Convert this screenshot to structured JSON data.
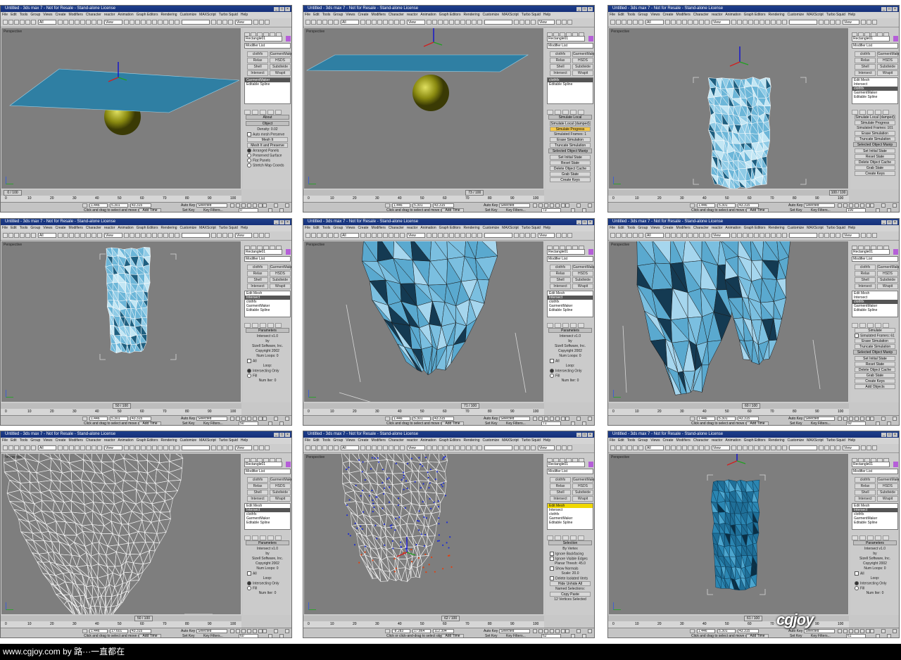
{
  "window_title": "Untitled - 3ds max 7 - Not for Resale - Stand-alone License",
  "menu": [
    "File",
    "Edit",
    "Tools",
    "Group",
    "Views",
    "Create",
    "Modifiers",
    "Character",
    "reactor",
    "Animation",
    "Graph Editors",
    "Rendering",
    "Customize",
    "MAXScript",
    "Turbo Squid",
    "Help"
  ],
  "toolbar": {
    "filter": "All",
    "view": "View",
    "ref": "View"
  },
  "viewport_label": "Perspective",
  "object_name": "Rectangle01",
  "modifier_list": "Modifier List",
  "modifier_buttons": [
    "clothfx",
    "GarmentMaker",
    "Relax",
    "HSDS",
    "Shell",
    "Subdivide",
    "Intersect",
    "Wrapit"
  ],
  "status": {
    "hint": "Click and drag to select and move objects",
    "hint2": "Click or click-and-drag to select objects",
    "add_time_tag": "Add Time Tag",
    "auto_key": "Auto Key",
    "set_key": "Set Key",
    "key_filters": "Key Filters...",
    "selected": "Selected"
  },
  "ruler": [
    "0",
    "10",
    "20",
    "30",
    "40",
    "50",
    "60",
    "70",
    "80",
    "90",
    "100"
  ],
  "panels": [
    {
      "frame": "0 / 100",
      "fv": "0",
      "x": "1.446",
      "y": "5.301",
      "z": "43.315",
      "mode": "plane",
      "stack": [
        "GarmentMaker",
        "Editable Spline"
      ],
      "sel": 0,
      "rollouts": [
        {
          "type": "hdr",
          "t": "About"
        },
        {
          "type": "hdr",
          "t": "Object"
        },
        {
          "type": "label",
          "t": "Density: 0.02"
        },
        {
          "type": "check",
          "t": "Auto mesh   Preserve"
        },
        {
          "type": "btn",
          "t": "Mesh It"
        },
        {
          "type": "btn",
          "t": "Mesh It and Preserve"
        },
        {
          "type": "radio",
          "t": "Arranged Panels",
          "on": true
        },
        {
          "type": "radio",
          "t": "Preserved Surface"
        },
        {
          "type": "radio",
          "t": "Flat Panels"
        },
        {
          "type": "radio",
          "t": "Stretch Map Coords"
        }
      ]
    },
    {
      "frame": "73 / 100",
      "fv": "73",
      "x": "1.446",
      "y": "5.301",
      "z": "43.315",
      "mode": "plane2",
      "stack": [
        "clothfx",
        "Editable Spline"
      ],
      "sel": 0,
      "rollouts": [
        {
          "type": "hdr",
          "t": "Simulate Local"
        },
        {
          "type": "btn",
          "t": "Simulate Local (damped)"
        },
        {
          "type": "btn",
          "t": "Simulate   Progress",
          "hl": true
        },
        {
          "type": "label",
          "t": "Simulated Frames:  1"
        },
        {
          "type": "btn",
          "t": "Erase Simulation"
        },
        {
          "type": "btn",
          "t": "Truncate Simulation"
        },
        {
          "type": "hdr",
          "t": "Selected Object Manip"
        },
        {
          "type": "btn",
          "t": "Set Initial State"
        },
        {
          "type": "btn",
          "t": "Reset State"
        },
        {
          "type": "btn",
          "t": "Delete Object Cache"
        },
        {
          "type": "btn",
          "t": "Grab State"
        },
        {
          "type": "btn",
          "t": "Create Keys"
        }
      ]
    },
    {
      "frame": "100 / 100",
      "fv": "100",
      "x": "1.446",
      "y": "5.301",
      "z": "43.315",
      "mode": "cloth_small",
      "stack": [
        "Edit Mesh",
        "Intersect",
        "clothfx",
        "GarmentMaker",
        "Editable Spline"
      ],
      "sel": 2,
      "rollouts": [
        {
          "type": "btn",
          "t": "Simulate Local (damped)"
        },
        {
          "type": "btn",
          "t": "Simulate   Progress"
        },
        {
          "type": "label",
          "t": "Simulated Frames:  101"
        },
        {
          "type": "btn",
          "t": "Erase Simulation"
        },
        {
          "type": "btn",
          "t": "Truncate Simulation"
        },
        {
          "type": "hdr",
          "t": "Selected Object Manip"
        },
        {
          "type": "btn",
          "t": "Set Initial State"
        },
        {
          "type": "btn",
          "t": "Reset State"
        },
        {
          "type": "btn",
          "t": "Delete Object Cache"
        },
        {
          "type": "btn",
          "t": "Grab State"
        },
        {
          "type": "btn",
          "t": "Create Keys"
        }
      ]
    },
    {
      "frame": "50 / 100",
      "fv": "50",
      "x": "1.446",
      "y": "5.301",
      "z": "43.315",
      "mode": "cloth_narrow",
      "stack": [
        "Edit Mesh",
        "Intersect",
        "clothfx",
        "GarmentMaker",
        "Editable Spline"
      ],
      "sel": 1,
      "rollouts": [
        {
          "type": "hdr",
          "t": "Parameters"
        },
        {
          "type": "label",
          "t": "Intersect v1.0"
        },
        {
          "type": "label",
          "t": "by"
        },
        {
          "type": "label",
          "t": "Sizell Software, Inc."
        },
        {
          "type": "label",
          "t": "Copyright 2002"
        },
        {
          "type": "label",
          "t": "Num Loops:   0"
        },
        {
          "type": "check",
          "t": "All"
        },
        {
          "type": "label",
          "t": "Loop:"
        },
        {
          "type": "radio",
          "t": "Intersecting Only",
          "on": true
        },
        {
          "type": "radio",
          "t": "Fill"
        },
        {
          "type": "label",
          "t": "Num Iter:   0"
        }
      ]
    },
    {
      "frame": "71 / 100",
      "fv": "71",
      "x": "1.446",
      "y": "5.301",
      "z": "43.315",
      "mode": "cloth_zoom",
      "stack": [
        "Edit Mesh",
        "Intersect",
        "clothfx",
        "GarmentMaker",
        "Editable Spline"
      ],
      "sel": 1,
      "rollouts": [
        {
          "type": "hdr",
          "t": "Parameters"
        },
        {
          "type": "label",
          "t": "Intersect v1.0"
        },
        {
          "type": "label",
          "t": "by"
        },
        {
          "type": "label",
          "t": "Sizell Software, Inc."
        },
        {
          "type": "label",
          "t": "Copyright 2002"
        },
        {
          "type": "label",
          "t": "Num Loops:   0"
        },
        {
          "type": "check",
          "t": "All"
        },
        {
          "type": "label",
          "t": "Loop:"
        },
        {
          "type": "radio",
          "t": "Intersecting Only",
          "on": true
        },
        {
          "type": "radio",
          "t": "Fill"
        },
        {
          "type": "label",
          "t": "Num Iter:   0"
        }
      ]
    },
    {
      "frame": "60 / 100",
      "fv": "60",
      "x": "1.446",
      "y": "5.301",
      "z": "43.315",
      "mode": "cloth_zoom2",
      "stack": [
        "Edit Mesh",
        "Intersect",
        "clothfx",
        "GarmentMaker",
        "Editable Spline"
      ],
      "sel": 2,
      "rollouts": [
        {
          "type": "btn",
          "t": "Simulate"
        },
        {
          "type": "check",
          "t": "Simulated Frames:  61"
        },
        {
          "type": "btn",
          "t": "Erase Simulation"
        },
        {
          "type": "btn",
          "t": "Truncate Simulation"
        },
        {
          "type": "hdr",
          "t": "Selected Object Manip"
        },
        {
          "type": "btn",
          "t": "Set Initial State"
        },
        {
          "type": "btn",
          "t": "Reset State"
        },
        {
          "type": "btn",
          "t": "Delete Object Cache"
        },
        {
          "type": "btn",
          "t": "Grab State"
        },
        {
          "type": "btn",
          "t": "Create Keys"
        },
        {
          "type": "btn",
          "t": "Add Objects"
        }
      ]
    },
    {
      "frame": "50 / 100",
      "fv": "60",
      "x": "1.446",
      "y": "17.601",
      "z": "43.315",
      "mode": "wire_white",
      "stack": [
        "Edit Mesh",
        "Intersect",
        "clothfx",
        "GarmentMaker",
        "Editable Spline"
      ],
      "sel": 1,
      "rollouts": [
        {
          "type": "hdr",
          "t": "Parameters"
        },
        {
          "type": "label",
          "t": "Intersect v1.0"
        },
        {
          "type": "label",
          "t": "by"
        },
        {
          "type": "label",
          "t": "Sizell Software, Inc."
        },
        {
          "type": "label",
          "t": "Copyright 2002"
        },
        {
          "type": "label",
          "t": "Num Loops:   0"
        },
        {
          "type": "check",
          "t": "All"
        },
        {
          "type": "label",
          "t": "Loop:"
        },
        {
          "type": "radio",
          "t": "Intersecting Only",
          "on": true
        },
        {
          "type": "radio",
          "t": "Fill"
        },
        {
          "type": "label",
          "t": "Num Iter:   0"
        }
      ]
    },
    {
      "frame": "62 / 100",
      "fv": "62",
      "x": "-8.283",
      "y": "17.864",
      "z": "112.394",
      "mode": "wire_blue",
      "stack": [
        "Edit Mesh",
        "Intersect",
        "clothfx",
        "GarmentMaker",
        "Editable Spline"
      ],
      "sel": 0,
      "yel": true,
      "rollouts": [
        {
          "type": "hdr",
          "t": "Selection"
        },
        {
          "type": "label",
          "t": "By Vertex"
        },
        {
          "type": "check",
          "t": "Ignore Backfacing"
        },
        {
          "type": "check",
          "t": "Ignore Visible Edges"
        },
        {
          "type": "label",
          "t": "Planar Thresh: 45.0"
        },
        {
          "type": "check",
          "t": "Show Normals"
        },
        {
          "type": "label",
          "t": "Scale: 20.0"
        },
        {
          "type": "check",
          "t": "Delete Isolated Verts"
        },
        {
          "type": "btn",
          "t": "Hide   Unhide All"
        },
        {
          "type": "label",
          "t": "Named Selections:"
        },
        {
          "type": "btn",
          "t": "Copy   Paste"
        },
        {
          "type": "label",
          "t": "12 Vertices Selected"
        }
      ]
    },
    {
      "frame": "61 / 100",
      "fv": "61",
      "x": "1.446",
      "y": "5.301",
      "z": "43.315",
      "mode": "cloth_dark",
      "stack": [
        "Edit Mesh",
        "Intersect",
        "clothfx",
        "GarmentMaker",
        "Editable Spline"
      ],
      "sel": 1,
      "rollouts": [
        {
          "type": "hdr",
          "t": "Parameters"
        },
        {
          "type": "label",
          "t": "Intersect v1.0"
        },
        {
          "type": "label",
          "t": "by"
        },
        {
          "type": "label",
          "t": "Sizell Software, Inc."
        },
        {
          "type": "label",
          "t": "Copyright 2002"
        },
        {
          "type": "label",
          "t": "Num Loops:   0"
        },
        {
          "type": "check",
          "t": "All"
        },
        {
          "type": "label",
          "t": "Loop:"
        },
        {
          "type": "radio",
          "t": "Intersecting Only",
          "on": true
        },
        {
          "type": "radio",
          "t": "Fill"
        },
        {
          "type": "label",
          "t": "Num Iter:   0"
        }
      ]
    }
  ],
  "footer": "www.cgjoy.com by 路···一直都在",
  "watermark": "cgjoy",
  "colors": {
    "cloth": "#4f9cc2",
    "cloth_dark": "#1e6e96",
    "sphere": "#9a9a14",
    "viewport": "#7e7e7e",
    "title": "#1e3f8a"
  }
}
